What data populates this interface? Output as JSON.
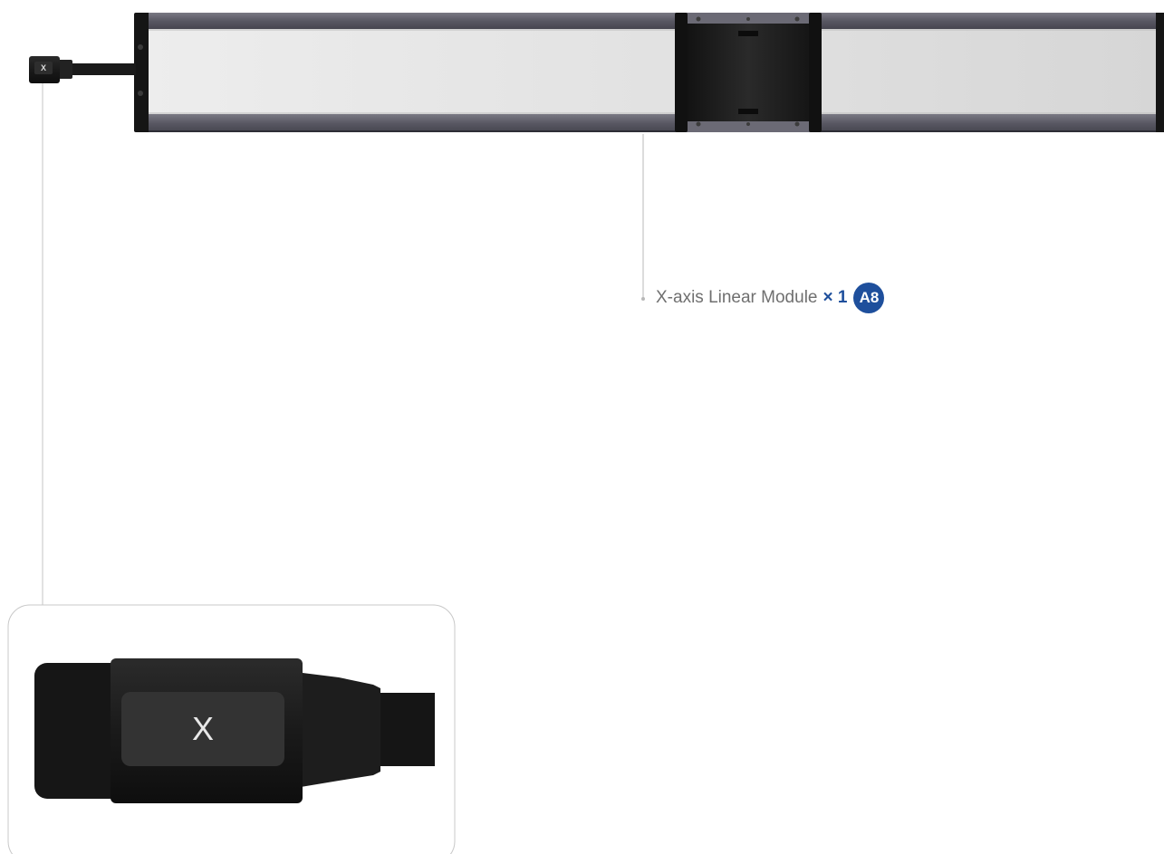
{
  "callout": {
    "part_name": "X-axis Linear Module",
    "quantity": "× 1",
    "part_code": "A8"
  },
  "connector": {
    "label": "X"
  },
  "colors": {
    "accent": "#1e4f9c",
    "leader_line": "#b8b8b8",
    "rail_frame": "#5e5d68",
    "rail_panel": "#e4e4e4",
    "carriage": "#1b1b1b",
    "connector_body": "#1a1a1a"
  }
}
